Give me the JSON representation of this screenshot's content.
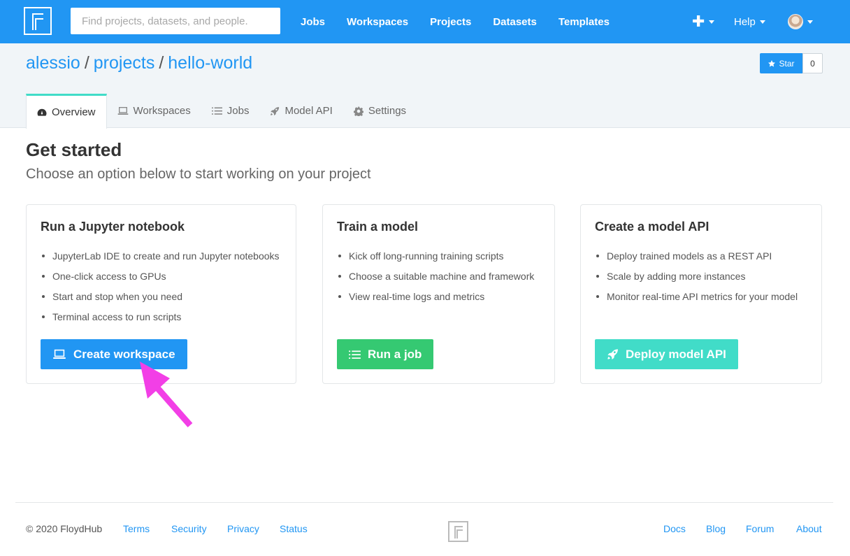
{
  "nav": {
    "search_placeholder": "Find projects, datasets, and people.",
    "links": [
      "Jobs",
      "Workspaces",
      "Projects",
      "Datasets",
      "Templates"
    ],
    "help_label": "Help"
  },
  "breadcrumb": {
    "user": "alessio",
    "section": "projects",
    "project": "hello-world",
    "separator": "/"
  },
  "star": {
    "label": "Star",
    "count": "0"
  },
  "tabs": [
    {
      "label": "Overview",
      "icon": "dashboard-icon",
      "active": true
    },
    {
      "label": "Workspaces",
      "icon": "laptop-icon"
    },
    {
      "label": "Jobs",
      "icon": "list-icon"
    },
    {
      "label": "Model API",
      "icon": "rocket-icon"
    },
    {
      "label": "Settings",
      "icon": "gear-icon"
    }
  ],
  "main": {
    "title": "Get started",
    "subtitle": "Choose an option below to start working on your project"
  },
  "cards": [
    {
      "title": "Run a Jupyter notebook",
      "items": [
        "JupyterLab IDE to create and run Jupyter notebooks",
        "One-click access to GPUs",
        "Start and stop when you need",
        "Terminal access to run scripts"
      ],
      "button": "Create workspace",
      "button_icon": "laptop-icon",
      "button_color": "#2196f3"
    },
    {
      "title": "Train a model",
      "items": [
        "Kick off long-running training scripts",
        "Choose a suitable machine and framework",
        "View real-time logs and metrics"
      ],
      "button": "Run a job",
      "button_icon": "list-icon",
      "button_color": "#35c972"
    },
    {
      "title": "Create a model API",
      "items": [
        "Deploy trained models as a REST API",
        "Scale by adding more instances",
        "Monitor real-time API metrics for your model"
      ],
      "button": "Deploy model API",
      "button_icon": "rocket-icon",
      "button_color": "#41dcc8"
    }
  ],
  "annotation_color": "#f23fe6",
  "footer": {
    "copyright": "© 2020 FloydHub",
    "left_links": [
      "Terms",
      "Security",
      "Privacy",
      "Status"
    ],
    "right_links": [
      "Docs",
      "Blog",
      "Forum",
      "About"
    ]
  }
}
